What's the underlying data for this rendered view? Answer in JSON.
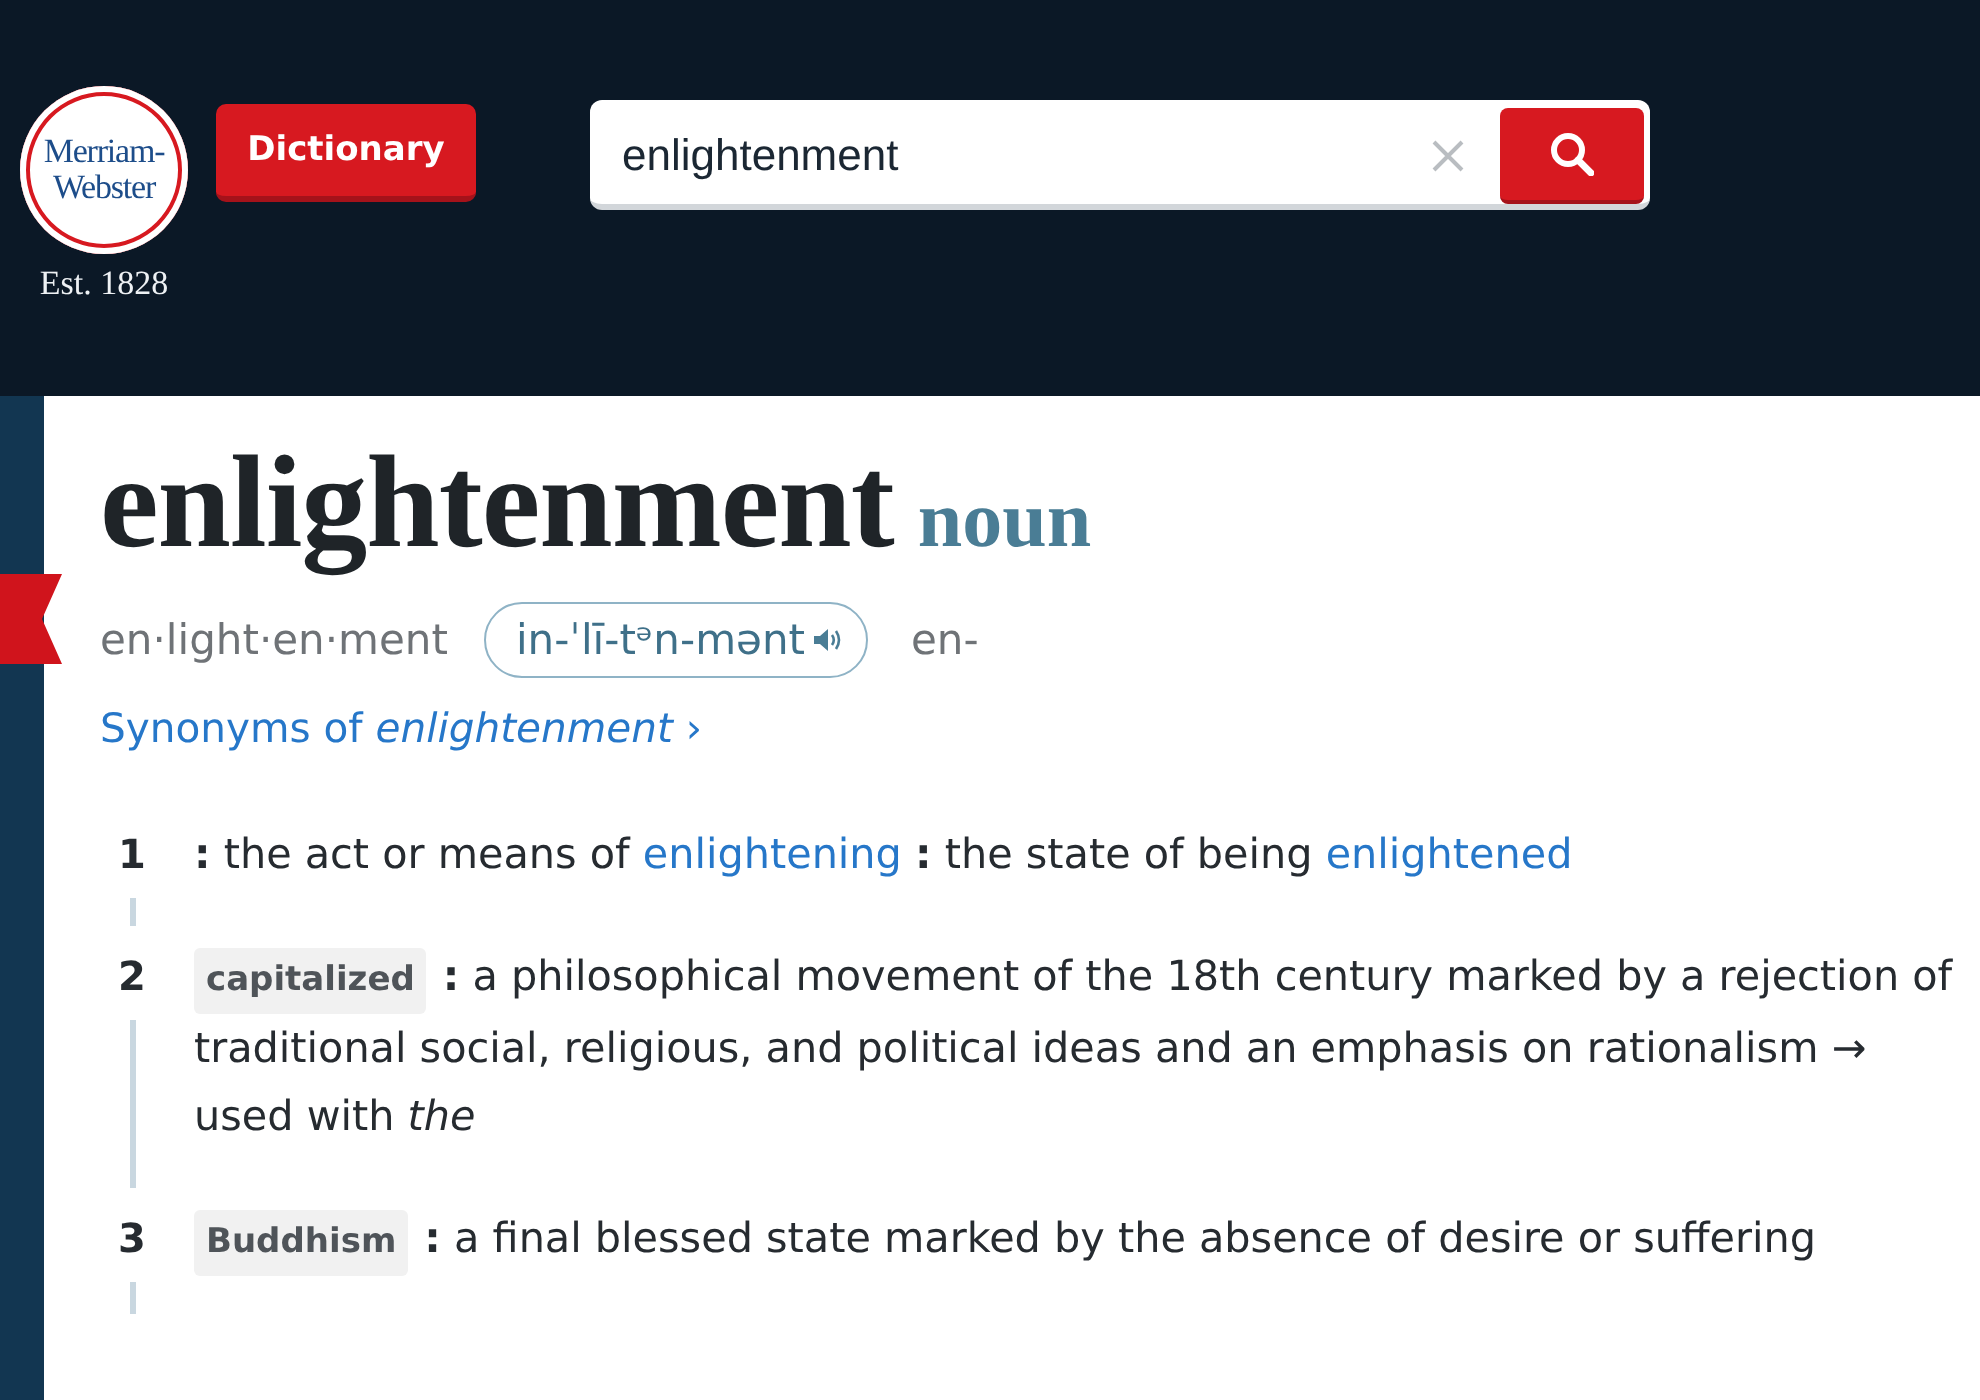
{
  "header": {
    "logo": {
      "lines": [
        "Merriam-",
        "Webster"
      ],
      "tagline": "Est. 1828"
    },
    "nav_button": "Dictionary",
    "search": {
      "value": "enlightenment"
    }
  },
  "entry": {
    "headword": "enlightenment",
    "part_of_speech": "noun",
    "syllables": "en·light·en·ment",
    "pronunciation": "in-ˈlī-tᵊn-mənt",
    "variant_pronunciation": "en-",
    "synonyms_link": "Synonyms of *enlightenment* ›"
  },
  "senses": [
    {
      "number": "1",
      "definition": [
        {
          "kind": "text",
          "text": "**:** the act or means of "
        },
        {
          "kind": "link",
          "text": "enlightening"
        },
        {
          "kind": "text",
          "text": " **:** the state of being "
        },
        {
          "kind": "link",
          "text": "enlightened"
        }
      ]
    },
    {
      "number": "2",
      "label": "capitalized",
      "definition": [
        {
          "kind": "text",
          "text": "**:** a philosophical movement of the 18th century marked by a rejection of traditional social, religious, and political ideas and an emphasis on rationalism → used with *the*"
        }
      ]
    },
    {
      "number": "3",
      "label": "Buddhism",
      "definition": [
        {
          "kind": "text",
          "text": "**:** a final blessed state marked by the absence of desire or suffering"
        }
      ]
    }
  ]
}
